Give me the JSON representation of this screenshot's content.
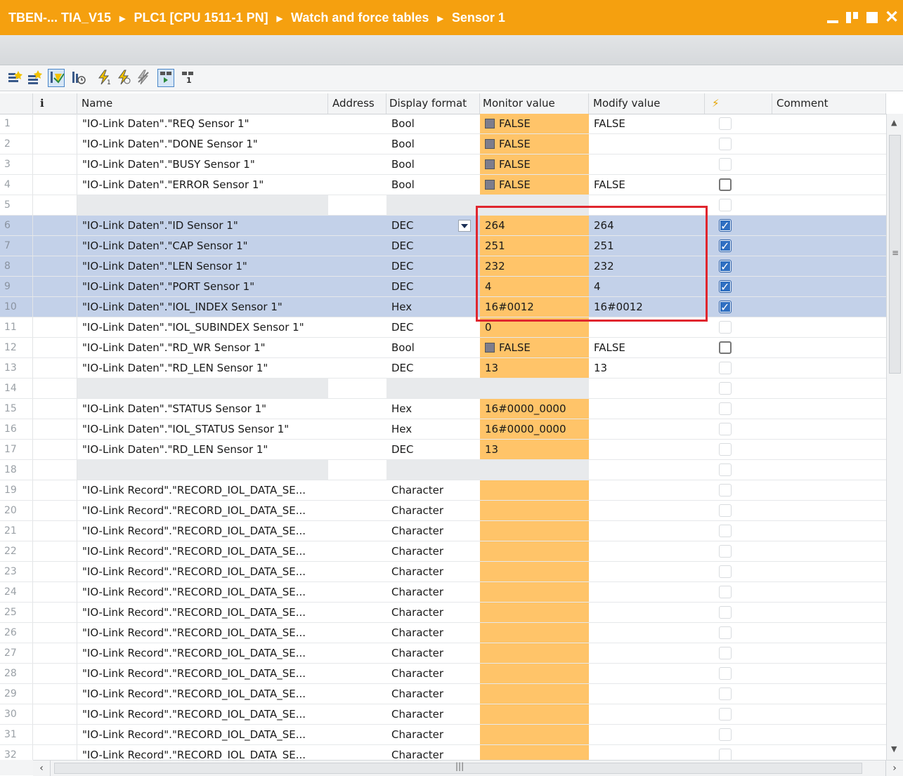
{
  "breadcrumb": {
    "items": [
      "TBEN-... TIA_V15",
      "PLC1 [CPU 1511-1 PN]",
      "Watch and force tables",
      "Sensor 1"
    ]
  },
  "window_controls": {
    "close_glyph": "✕"
  },
  "toolbar": {
    "icons": [
      "insert-row-icon",
      "add-row-icon",
      "monitor-all-icon",
      "monitor-once-icon",
      "modify-now-icon",
      "modify-trigger-icon",
      "enable-peripheral-icon",
      "show-force-columns-icon",
      "force-icon"
    ]
  },
  "table": {
    "headers": {
      "info": "i",
      "name": "Name",
      "address": "Address",
      "display_format": "Display format",
      "monitor_value": "Monitor value",
      "modify_value": "Modify value",
      "force": "⚡",
      "comment": "Comment"
    },
    "rows": [
      {
        "n": "1",
        "name": "\"IO-Link Daten\".\"REQ Sensor 1\"",
        "fmt": "Bool",
        "mon": "FALSE",
        "bool": true,
        "mod": "FALSE",
        "cb": "dim"
      },
      {
        "n": "2",
        "name": "\"IO-Link Daten\".\"DONE Sensor 1\"",
        "fmt": "Bool",
        "mon": "FALSE",
        "bool": true,
        "mod": "",
        "cb": "dim"
      },
      {
        "n": "3",
        "name": "\"IO-Link Daten\".\"BUSY Sensor 1\"",
        "fmt": "Bool",
        "mon": "FALSE",
        "bool": true,
        "mod": "",
        "cb": "dim"
      },
      {
        "n": "4",
        "name": "\"IO-Link Daten\".\"ERROR Sensor 1\"",
        "fmt": "Bool",
        "mon": "FALSE",
        "bool": true,
        "mod": "FALSE",
        "cb": "boxed"
      },
      {
        "n": "5",
        "name": "",
        "fmt": "",
        "mon": "",
        "empty": true,
        "mod": "",
        "cb": "dim"
      },
      {
        "n": "6",
        "name": "\"IO-Link Daten\".\"ID Sensor 1\"",
        "fmt": "DEC",
        "mon": "264",
        "mod": "264",
        "cb": "checked",
        "sel": true,
        "dropdown": true
      },
      {
        "n": "7",
        "name": "\"IO-Link Daten\".\"CAP Sensor 1\"",
        "fmt": "DEC",
        "mon": "251",
        "mod": "251",
        "cb": "checked",
        "sel": true
      },
      {
        "n": "8",
        "name": "\"IO-Link Daten\".\"LEN Sensor 1\"",
        "fmt": "DEC",
        "mon": "232",
        "mod": "232",
        "cb": "checked",
        "sel": true
      },
      {
        "n": "9",
        "name": "\"IO-Link Daten\".\"PORT Sensor 1\"",
        "fmt": "DEC",
        "mon": "4",
        "mod": "4",
        "cb": "checked",
        "sel": true
      },
      {
        "n": "10",
        "name": "\"IO-Link Daten\".\"IOL_INDEX Sensor 1\"",
        "fmt": "Hex",
        "mon": "16#0012",
        "mod": "16#0012",
        "cb": "checked",
        "sel": true
      },
      {
        "n": "11",
        "name": "\"IO-Link Daten\".\"IOL_SUBINDEX Sensor 1\"",
        "fmt": "DEC",
        "mon": "0",
        "mod": "",
        "cb": "dim"
      },
      {
        "n": "12",
        "name": "\"IO-Link Daten\".\"RD_WR Sensor 1\"",
        "fmt": "Bool",
        "mon": "FALSE",
        "bool": true,
        "mod": "FALSE",
        "cb": "boxed"
      },
      {
        "n": "13",
        "name": "\"IO-Link Daten\".\"RD_LEN Sensor 1\"",
        "fmt": "DEC",
        "mon": "13",
        "mod": "13",
        "cb": "dim"
      },
      {
        "n": "14",
        "name": "",
        "fmt": "",
        "mon": "",
        "empty": true,
        "mod": "",
        "cb": "dim"
      },
      {
        "n": "15",
        "name": "\"IO-Link Daten\".\"STATUS Sensor 1\"",
        "fmt": "Hex",
        "mon": "16#0000_0000",
        "mod": "",
        "cb": "dim"
      },
      {
        "n": "16",
        "name": "\"IO-Link Daten\".\"IOL_STATUS Sensor 1\"",
        "fmt": "Hex",
        "mon": "16#0000_0000",
        "mod": "",
        "cb": "dim"
      },
      {
        "n": "17",
        "name": "\"IO-Link Daten\".\"RD_LEN Sensor 1\"",
        "fmt": "DEC",
        "mon": "13",
        "mod": "",
        "cb": "dim"
      },
      {
        "n": "18",
        "name": "",
        "fmt": "",
        "mon": "",
        "empty": true,
        "mod": "",
        "cb": "dim"
      },
      {
        "n": "19",
        "name": "\"IO-Link Record\".\"RECORD_IOL_DATA_SE...",
        "fmt": "Character",
        "mon": "",
        "mod": "",
        "cb": "dim"
      },
      {
        "n": "20",
        "name": "\"IO-Link Record\".\"RECORD_IOL_DATA_SE...",
        "fmt": "Character",
        "mon": "",
        "mod": "",
        "cb": "dim"
      },
      {
        "n": "21",
        "name": "\"IO-Link Record\".\"RECORD_IOL_DATA_SE...",
        "fmt": "Character",
        "mon": "",
        "mod": "",
        "cb": "dim"
      },
      {
        "n": "22",
        "name": "\"IO-Link Record\".\"RECORD_IOL_DATA_SE...",
        "fmt": "Character",
        "mon": "",
        "mod": "",
        "cb": "dim"
      },
      {
        "n": "23",
        "name": "\"IO-Link Record\".\"RECORD_IOL_DATA_SE...",
        "fmt": "Character",
        "mon": "",
        "mod": "",
        "cb": "dim"
      },
      {
        "n": "24",
        "name": "\"IO-Link Record\".\"RECORD_IOL_DATA_SE...",
        "fmt": "Character",
        "mon": "",
        "mod": "",
        "cb": "dim"
      },
      {
        "n": "25",
        "name": "\"IO-Link Record\".\"RECORD_IOL_DATA_SE...",
        "fmt": "Character",
        "mon": "",
        "mod": "",
        "cb": "dim"
      },
      {
        "n": "26",
        "name": "\"IO-Link Record\".\"RECORD_IOL_DATA_SE...",
        "fmt": "Character",
        "mon": "",
        "mod": "",
        "cb": "dim"
      },
      {
        "n": "27",
        "name": "\"IO-Link Record\".\"RECORD_IOL_DATA_SE...",
        "fmt": "Character",
        "mon": "",
        "mod": "",
        "cb": "dim"
      },
      {
        "n": "28",
        "name": "\"IO-Link Record\".\"RECORD_IOL_DATA_SE...",
        "fmt": "Character",
        "mon": "",
        "mod": "",
        "cb": "dim"
      },
      {
        "n": "29",
        "name": "\"IO-Link Record\".\"RECORD_IOL_DATA_SE...",
        "fmt": "Character",
        "mon": "",
        "mod": "",
        "cb": "dim"
      },
      {
        "n": "30",
        "name": "\"IO-Link Record\".\"RECORD_IOL_DATA_SE...",
        "fmt": "Character",
        "mon": "",
        "mod": "",
        "cb": "dim"
      },
      {
        "n": "31",
        "name": "\"IO-Link Record\".\"RECORD_IOL_DATA_SE...",
        "fmt": "Character",
        "mon": "",
        "mod": "",
        "cb": "dim"
      },
      {
        "n": "32",
        "name": "\"IO-Link Record\".\"RECORD_IOL_DATA_SE...",
        "fmt": "Character",
        "mon": "",
        "mod": "",
        "cb": "dim"
      }
    ]
  },
  "colors": {
    "title_bar": "#f5a00f",
    "monitor_value_bg": "#ffc469",
    "selected_row_bg": "#c3d1e9",
    "highlight_box": "#e0262e",
    "checkbox_checked": "#2f6fc1"
  }
}
